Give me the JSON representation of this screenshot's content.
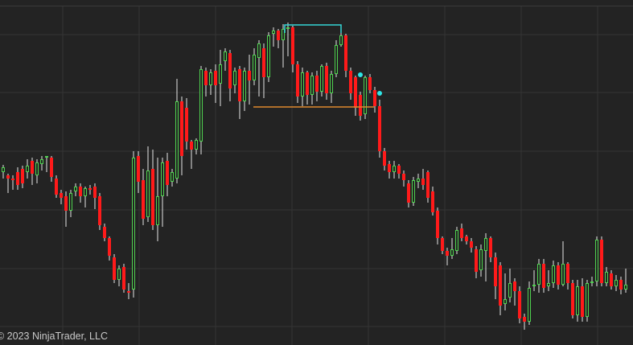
{
  "chart_data": {
    "type": "candlestick",
    "title": "",
    "xlabel": "",
    "ylabel": "",
    "ylim": [
      0,
      429
    ],
    "grid": true,
    "watermark": "© 2023 NinjaTrader, LLC",
    "colors": {
      "background": "#232323",
      "grid": "#343434",
      "top_border": "#3a3a3a",
      "up": "#4fd14f",
      "down": "#ff1a1a",
      "wick": "#e6e6e6",
      "support_line": "#e08a2e",
      "resistance_line": "#35d6d6",
      "markers": "#2ee6e6"
    },
    "candles": [
      [
        4,
        214,
        208,
        205,
        222
      ],
      [
        10,
        218,
        222,
        216,
        240
      ],
      [
        16,
        222,
        224,
        218,
        236
      ],
      [
        22,
        214,
        230,
        208,
        236
      ],
      [
        28,
        210,
        228,
        206,
        234
      ],
      [
        34,
        214,
        206,
        198,
        222
      ],
      [
        40,
        200,
        216,
        196,
        230
      ],
      [
        46,
        218,
        202,
        198,
        228
      ],
      [
        52,
        204,
        198,
        194,
        212
      ],
      [
        58,
        196,
        194,
        194,
        214
      ],
      [
        64,
        196,
        220,
        194,
        226
      ],
      [
        70,
        222,
        242,
        218,
        246
      ],
      [
        76,
        240,
        246,
        236,
        254
      ],
      [
        82,
        244,
        262,
        238,
        282
      ],
      [
        88,
        262,
        240,
        236,
        270
      ],
      [
        94,
        238,
        232,
        228,
        244
      ],
      [
        100,
        232,
        244,
        228,
        252
      ],
      [
        106,
        244,
        234,
        232,
        258
      ],
      [
        112,
        234,
        236,
        230,
        242
      ],
      [
        118,
        232,
        246,
        228,
        260
      ],
      [
        124,
        244,
        280,
        240,
        286
      ],
      [
        130,
        282,
        296,
        278,
        300
      ],
      [
        136,
        296,
        318,
        294,
        324
      ],
      [
        142,
        320,
        348,
        316,
        352
      ],
      [
        148,
        348,
        334,
        330,
        356
      ],
      [
        154,
        332,
        360,
        328,
        364
      ],
      [
        160,
        362,
        364,
        352,
        372
      ],
      [
        166,
        360,
        196,
        188,
        370
      ],
      [
        172,
        194,
        226,
        188,
        240
      ],
      [
        178,
        224,
        272,
        210,
        280
      ],
      [
        184,
        270,
        212,
        182,
        276
      ],
      [
        190,
        210,
        280,
        186,
        286
      ],
      [
        196,
        280,
        244,
        196,
        300
      ],
      [
        202,
        244,
        202,
        196,
        282
      ],
      [
        208,
        200,
        230,
        190,
        244
      ],
      [
        214,
        226,
        214,
        210,
        232
      ],
      [
        220,
        222,
        126,
        98,
        228
      ],
      [
        226,
        126,
        194,
        120,
        218
      ],
      [
        232,
        134,
        176,
        122,
        186
      ],
      [
        238,
        176,
        186,
        174,
        210
      ],
      [
        244,
        186,
        174,
        172,
        192
      ],
      [
        250,
        176,
        86,
        82,
        192
      ],
      [
        256,
        88,
        106,
        84,
        120
      ],
      [
        262,
        106,
        90,
        86,
        118
      ],
      [
        268,
        88,
        106,
        80,
        128
      ],
      [
        274,
        104,
        80,
        62,
        132
      ],
      [
        280,
        76,
        64,
        60,
        88
      ],
      [
        286,
        66,
        110,
        62,
        126
      ],
      [
        292,
        106,
        88,
        84,
        116
      ],
      [
        298,
        86,
        126,
        82,
        148
      ],
      [
        304,
        126,
        88,
        84,
        138
      ],
      [
        310,
        88,
        100,
        68,
        130
      ],
      [
        316,
        100,
        68,
        60,
        106
      ],
      [
        322,
        72,
        54,
        50,
        120
      ],
      [
        328,
        60,
        96,
        54,
        122
      ],
      [
        334,
        96,
        44,
        40,
        102
      ],
      [
        340,
        42,
        38,
        34,
        58
      ],
      [
        346,
        38,
        50,
        36,
        60
      ],
      [
        352,
        50,
        36,
        30,
        84
      ],
      [
        358,
        36,
        34,
        28,
        70
      ],
      [
        364,
        34,
        80,
        32,
        90
      ],
      [
        370,
        80,
        120,
        76,
        128
      ],
      [
        376,
        120,
        90,
        84,
        132
      ],
      [
        382,
        90,
        118,
        88,
        130
      ],
      [
        388,
        118,
        94,
        90,
        130
      ],
      [
        394,
        94,
        114,
        88,
        126
      ],
      [
        400,
        114,
        82,
        80,
        120
      ],
      [
        406,
        82,
        116,
        78,
        124
      ],
      [
        412,
        116,
        92,
        88,
        128
      ],
      [
        418,
        92,
        56,
        50,
        96
      ],
      [
        424,
        56,
        44,
        40,
        58
      ],
      [
        430,
        44,
        88,
        42,
        96
      ],
      [
        436,
        88,
        116,
        84,
        124
      ],
      [
        442,
        96,
        134,
        94,
        144
      ],
      [
        448,
        118,
        144,
        114,
        150
      ],
      [
        454,
        142,
        96,
        94,
        148
      ],
      [
        460,
        96,
        112,
        92,
        116
      ],
      [
        466,
        112,
        132,
        108,
        140
      ],
      [
        472,
        132,
        188,
        124,
        196
      ],
      [
        478,
        188,
        206,
        184,
        212
      ],
      [
        484,
        204,
        214,
        200,
        222
      ],
      [
        490,
        214,
        206,
        200,
        222
      ],
      [
        496,
        206,
        216,
        204,
        222
      ],
      [
        502,
        216,
        224,
        212,
        232
      ],
      [
        508,
        228,
        252,
        224,
        258
      ],
      [
        514,
        252,
        224,
        220,
        256
      ],
      [
        520,
        226,
        222,
        216,
        234
      ],
      [
        526,
        222,
        230,
        210,
        236
      ],
      [
        532,
        214,
        246,
        212,
        252
      ],
      [
        538,
        238,
        264,
        232,
        268
      ],
      [
        544,
        262,
        296,
        258,
        304
      ],
      [
        550,
        296,
        312,
        294,
        316
      ],
      [
        556,
        312,
        318,
        308,
        330
      ],
      [
        562,
        318,
        310,
        296,
        322
      ],
      [
        568,
        312,
        286,
        282,
        316
      ],
      [
        574,
        284,
        296,
        278,
        300
      ],
      [
        580,
        294,
        300,
        292,
        304
      ],
      [
        586,
        300,
        308,
        296,
        314
      ],
      [
        592,
        310,
        338,
        306,
        346
      ],
      [
        598,
        336,
        310,
        304,
        344
      ],
      [
        604,
        312,
        296,
        290,
        350
      ],
      [
        610,
        296,
        320,
        294,
        326
      ],
      [
        616,
        320,
        356,
        314,
        372
      ],
      [
        622,
        330,
        380,
        326,
        392
      ],
      [
        628,
        378,
        372,
        340,
        386
      ],
      [
        634,
        370,
        352,
        334,
        376
      ],
      [
        640,
        350,
        362,
        346,
        380
      ],
      [
        646,
        362,
        396,
        356,
        402
      ],
      [
        652,
        394,
        400,
        390,
        410
      ],
      [
        658,
        400,
        358,
        350,
        404
      ],
      [
        664,
        356,
        354,
        336,
        362
      ],
      [
        670,
        354,
        328,
        322,
        364
      ],
      [
        676,
        328,
        358,
        322,
        364
      ],
      [
        682,
        356,
        352,
        336,
        362
      ],
      [
        688,
        352,
        330,
        324,
        358
      ],
      [
        694,
        330,
        354,
        326,
        360
      ],
      [
        700,
        354,
        328,
        300,
        356
      ],
      [
        706,
        328,
        352,
        326,
        360
      ],
      [
        712,
        352,
        392,
        348,
        396
      ],
      [
        718,
        392,
        356,
        348,
        400
      ],
      [
        724,
        356,
        394,
        346,
        400
      ],
      [
        730,
        394,
        352,
        348,
        400
      ],
      [
        736,
        352,
        350,
        344,
        356
      ],
      [
        742,
        350,
        298,
        294,
        356
      ],
      [
        748,
        298,
        352,
        294,
        356
      ],
      [
        754,
        352,
        338,
        332,
        356
      ],
      [
        760,
        340,
        356,
        336,
        360
      ],
      [
        766,
        356,
        348,
        342,
        362
      ],
      [
        772,
        348,
        360,
        344,
        366
      ],
      [
        778,
        360,
        354,
        334,
        364
      ]
    ],
    "annotations": [
      {
        "type": "bracket",
        "x1": 354,
        "x2": 424,
        "y": 31,
        "drop": 10
      },
      {
        "type": "hline",
        "x1": 315,
        "x2": 465,
        "y": 133
      },
      {
        "type": "dot",
        "x": 448,
        "y": 93
      },
      {
        "type": "dot",
        "x": 472,
        "y": 116
      }
    ]
  }
}
